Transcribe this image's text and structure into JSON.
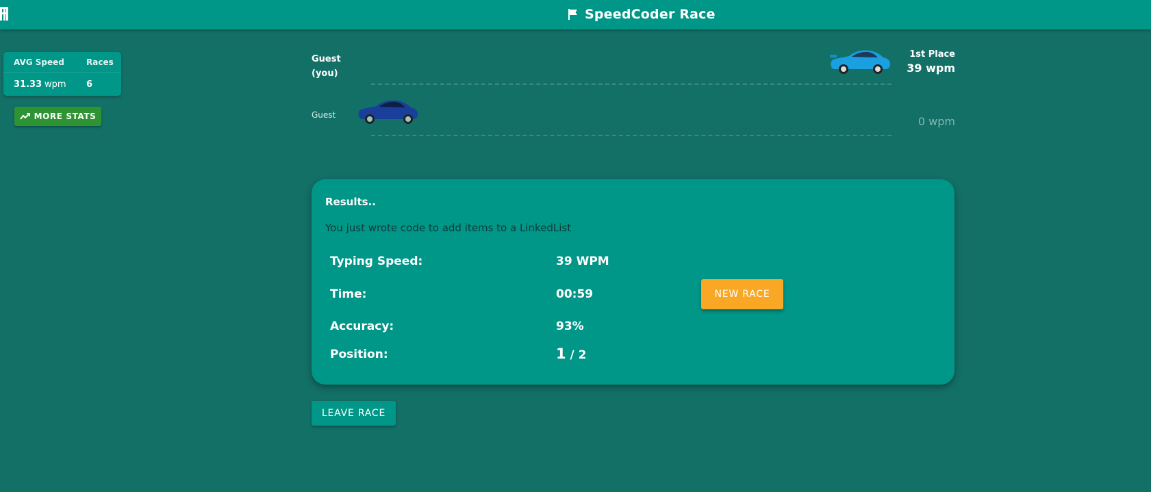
{
  "header": {
    "title": "SpeedCoder Race",
    "title_icon": "flag-icon",
    "corner_icon": "cut-off-glyph-icon"
  },
  "stats": {
    "avg_label": "AVG Speed",
    "races_label": "Races",
    "avg_value": "31.33",
    "avg_unit": "wpm",
    "races_value": "6",
    "more_stats_label": "MORE STATS",
    "more_stats_icon": "trending-up-icon"
  },
  "track": {
    "players": [
      {
        "name": "Guest",
        "you_suffix": "(you)",
        "place": "1st Place",
        "wpm": "39 wpm",
        "car_color": "#1aa0e0",
        "progress": 1.0
      },
      {
        "name": "Guest",
        "wpm": "0 wpm",
        "car_color": "#1a3f9a",
        "progress": 0.0
      }
    ]
  },
  "results": {
    "heading": "Results..",
    "description": "You just wrote code to add items to a LinkedList",
    "typing_speed_label": "Typing Speed:",
    "typing_speed_value": "39 WPM",
    "time_label": "Time:",
    "time_value": "00:59",
    "accuracy_label": "Accuracy:",
    "accuracy_value": "93%",
    "position_label": "Position:",
    "position_value": "1",
    "position_total": "/ 2",
    "new_race_label": "NEW RACE"
  },
  "leave_race_label": "LEAVE RACE",
  "colors": {
    "background": "#137067",
    "primary": "#009688",
    "accent": "#f9a825",
    "success": "#2e9433"
  }
}
